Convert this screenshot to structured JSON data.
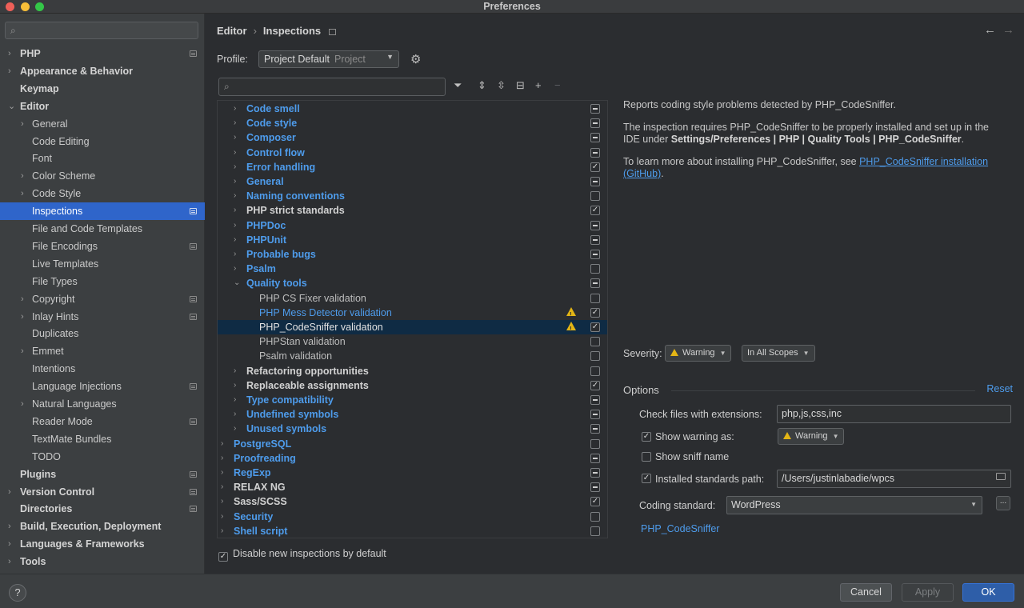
{
  "window": {
    "title": "Preferences",
    "traffic_colors": [
      "#ee5f58",
      "#f8be38",
      "#34c748"
    ]
  },
  "sidebar": {
    "search_placeholder": "",
    "items": [
      {
        "label": "PHP",
        "level": 0,
        "bold": true,
        "chevron": true,
        "project": true
      },
      {
        "label": "Appearance & Behavior",
        "level": 0,
        "bold": true,
        "chevron": true
      },
      {
        "label": "Keymap",
        "level": 0,
        "bold": true
      },
      {
        "label": "Editor",
        "level": 0,
        "bold": true,
        "chevron": true,
        "expanded": true
      },
      {
        "label": "General",
        "level": 1,
        "chevron": true
      },
      {
        "label": "Code Editing",
        "level": 1
      },
      {
        "label": "Font",
        "level": 1
      },
      {
        "label": "Color Scheme",
        "level": 1,
        "chevron": true
      },
      {
        "label": "Code Style",
        "level": 1,
        "chevron": true
      },
      {
        "label": "Inspections",
        "level": 1,
        "selected": true,
        "project": true
      },
      {
        "label": "File and Code Templates",
        "level": 1
      },
      {
        "label": "File Encodings",
        "level": 1,
        "project": true
      },
      {
        "label": "Live Templates",
        "level": 1
      },
      {
        "label": "File Types",
        "level": 1
      },
      {
        "label": "Copyright",
        "level": 1,
        "chevron": true,
        "project": true
      },
      {
        "label": "Inlay Hints",
        "level": 1,
        "chevron": true,
        "project": true
      },
      {
        "label": "Duplicates",
        "level": 1
      },
      {
        "label": "Emmet",
        "level": 1,
        "chevron": true
      },
      {
        "label": "Intentions",
        "level": 1
      },
      {
        "label": "Language Injections",
        "level": 1,
        "project": true
      },
      {
        "label": "Natural Languages",
        "level": 1,
        "chevron": true
      },
      {
        "label": "Reader Mode",
        "level": 1,
        "project": true
      },
      {
        "label": "TextMate Bundles",
        "level": 1
      },
      {
        "label": "TODO",
        "level": 1
      },
      {
        "label": "Plugins",
        "level": 0,
        "bold": true,
        "project": true
      },
      {
        "label": "Version Control",
        "level": 0,
        "bold": true,
        "chevron": true,
        "project": true
      },
      {
        "label": "Directories",
        "level": 0,
        "bold": true,
        "project": true
      },
      {
        "label": "Build, Execution, Deployment",
        "level": 0,
        "bold": true,
        "chevron": true
      },
      {
        "label": "Languages & Frameworks",
        "level": 0,
        "bold": true,
        "chevron": true
      },
      {
        "label": "Tools",
        "level": 0,
        "bold": true,
        "chevron": true
      }
    ]
  },
  "header": {
    "crumb_parent": "Editor",
    "crumb_separator": "›",
    "crumb_current": "Inspections",
    "back_icon": "←",
    "forward_icon": "→"
  },
  "profile": {
    "label": "Profile:",
    "value": "Project Default",
    "sub": "Project"
  },
  "tree": {
    "rows": [
      {
        "label": "Code smell",
        "indent": 1,
        "chevron": "›",
        "style": "blue",
        "check": "partial"
      },
      {
        "label": "Code style",
        "indent": 1,
        "chevron": "›",
        "style": "blue",
        "check": "partial"
      },
      {
        "label": "Composer",
        "indent": 1,
        "chevron": "›",
        "style": "blue",
        "check": "partial"
      },
      {
        "label": "Control flow",
        "indent": 1,
        "chevron": "›",
        "style": "blue",
        "check": "partial"
      },
      {
        "label": "Error handling",
        "indent": 1,
        "chevron": "›",
        "style": "blue",
        "check": "checked"
      },
      {
        "label": "General",
        "indent": 1,
        "chevron": "›",
        "style": "blue",
        "check": "partial"
      },
      {
        "label": "Naming conventions",
        "indent": 1,
        "chevron": "›",
        "style": "blue",
        "check": "none"
      },
      {
        "label": "PHP strict standards",
        "indent": 1,
        "chevron": "›",
        "style": "white",
        "check": "checked"
      },
      {
        "label": "PHPDoc",
        "indent": 1,
        "chevron": "›",
        "style": "blue",
        "check": "partial"
      },
      {
        "label": "PHPUnit",
        "indent": 1,
        "chevron": "›",
        "style": "blue",
        "check": "partial"
      },
      {
        "label": "Probable bugs",
        "indent": 1,
        "chevron": "›",
        "style": "blue",
        "check": "partial"
      },
      {
        "label": "Psalm",
        "indent": 1,
        "chevron": "›",
        "style": "blue",
        "check": "none"
      },
      {
        "label": "Quality tools",
        "indent": 1,
        "chevron": "⌄",
        "style": "blue",
        "check": "partial"
      },
      {
        "label": "PHP CS Fixer validation",
        "indent": 2,
        "chevron": "",
        "style": "plain",
        "check": "none"
      },
      {
        "label": "PHP Mess Detector validation",
        "indent": 2,
        "chevron": "",
        "style": "bluep",
        "check": "checked",
        "warning": true
      },
      {
        "label": "PHP_CodeSniffer validation",
        "indent": 2,
        "chevron": "",
        "style": "plain",
        "check": "checked",
        "warning": true,
        "selected": true
      },
      {
        "label": "PHPStan validation",
        "indent": 2,
        "chevron": "",
        "style": "plain",
        "check": "none"
      },
      {
        "label": "Psalm validation",
        "indent": 2,
        "chevron": "",
        "style": "plain",
        "check": "none"
      },
      {
        "label": "Refactoring opportunities",
        "indent": 1,
        "chevron": "›",
        "style": "white",
        "check": "none"
      },
      {
        "label": "Replaceable assignments",
        "indent": 1,
        "chevron": "›",
        "style": "white",
        "check": "checked"
      },
      {
        "label": "Type compatibility",
        "indent": 1,
        "chevron": "›",
        "style": "blue",
        "check": "partial"
      },
      {
        "label": "Undefined symbols",
        "indent": 1,
        "chevron": "›",
        "style": "blue",
        "check": "partial"
      },
      {
        "label": "Unused symbols",
        "indent": 1,
        "chevron": "›",
        "style": "blue",
        "check": "partial"
      },
      {
        "label": "PostgreSQL",
        "indent": 0,
        "chevron": "›",
        "style": "blue",
        "check": "none"
      },
      {
        "label": "Proofreading",
        "indent": 0,
        "chevron": "›",
        "style": "blue",
        "check": "partial"
      },
      {
        "label": "RegExp",
        "indent": 0,
        "chevron": "›",
        "style": "blue",
        "check": "partial"
      },
      {
        "label": "RELAX NG",
        "indent": 0,
        "chevron": "›",
        "style": "white",
        "check": "partial"
      },
      {
        "label": "Sass/SCSS",
        "indent": 0,
        "chevron": "›",
        "style": "white",
        "check": "checked"
      },
      {
        "label": "Security",
        "indent": 0,
        "chevron": "›",
        "style": "blue",
        "check": "none"
      },
      {
        "label": "Shell script",
        "indent": 0,
        "chevron": "›",
        "style": "blue",
        "check": "none"
      }
    ],
    "disable_new_label": "Disable new inspections by default"
  },
  "description": {
    "p1": "Reports coding style problems detected by PHP_CodeSniffer.",
    "p2_pre": "The inspection requires PHP_CodeSniffer to be properly installed and set up in the IDE under ",
    "p2_bold": "Settings/Preferences | PHP | Quality Tools | PHP_CodeSniffer",
    "p2_post": ".",
    "p3_pre": "To learn more about installing PHP_CodeSniffer, see ",
    "p3_link": "PHP_CodeSniffer installation (GitHub)",
    "p3_post": "."
  },
  "severity": {
    "label": "Severity:",
    "value": "Warning",
    "scope": "In All Scopes"
  },
  "options": {
    "title": "Options",
    "reset": "Reset",
    "extensions_label": "Check files with extensions:",
    "extensions_value": "php,js,css,inc",
    "show_warning_label": "Show warning as:",
    "show_warning_value": "Warning",
    "show_sniff_label": "Show sniff name",
    "installed_path_label": "Installed standards path:",
    "installed_path_value": "/Users/justinlabadie/wpcs",
    "coding_standard_label": "Coding standard:",
    "coding_standard_value": "WordPress",
    "ellipsis": "...",
    "link": "PHP_CodeSniffer"
  },
  "footer": {
    "help": "?",
    "cancel": "Cancel",
    "apply": "Apply",
    "ok": "OK"
  }
}
